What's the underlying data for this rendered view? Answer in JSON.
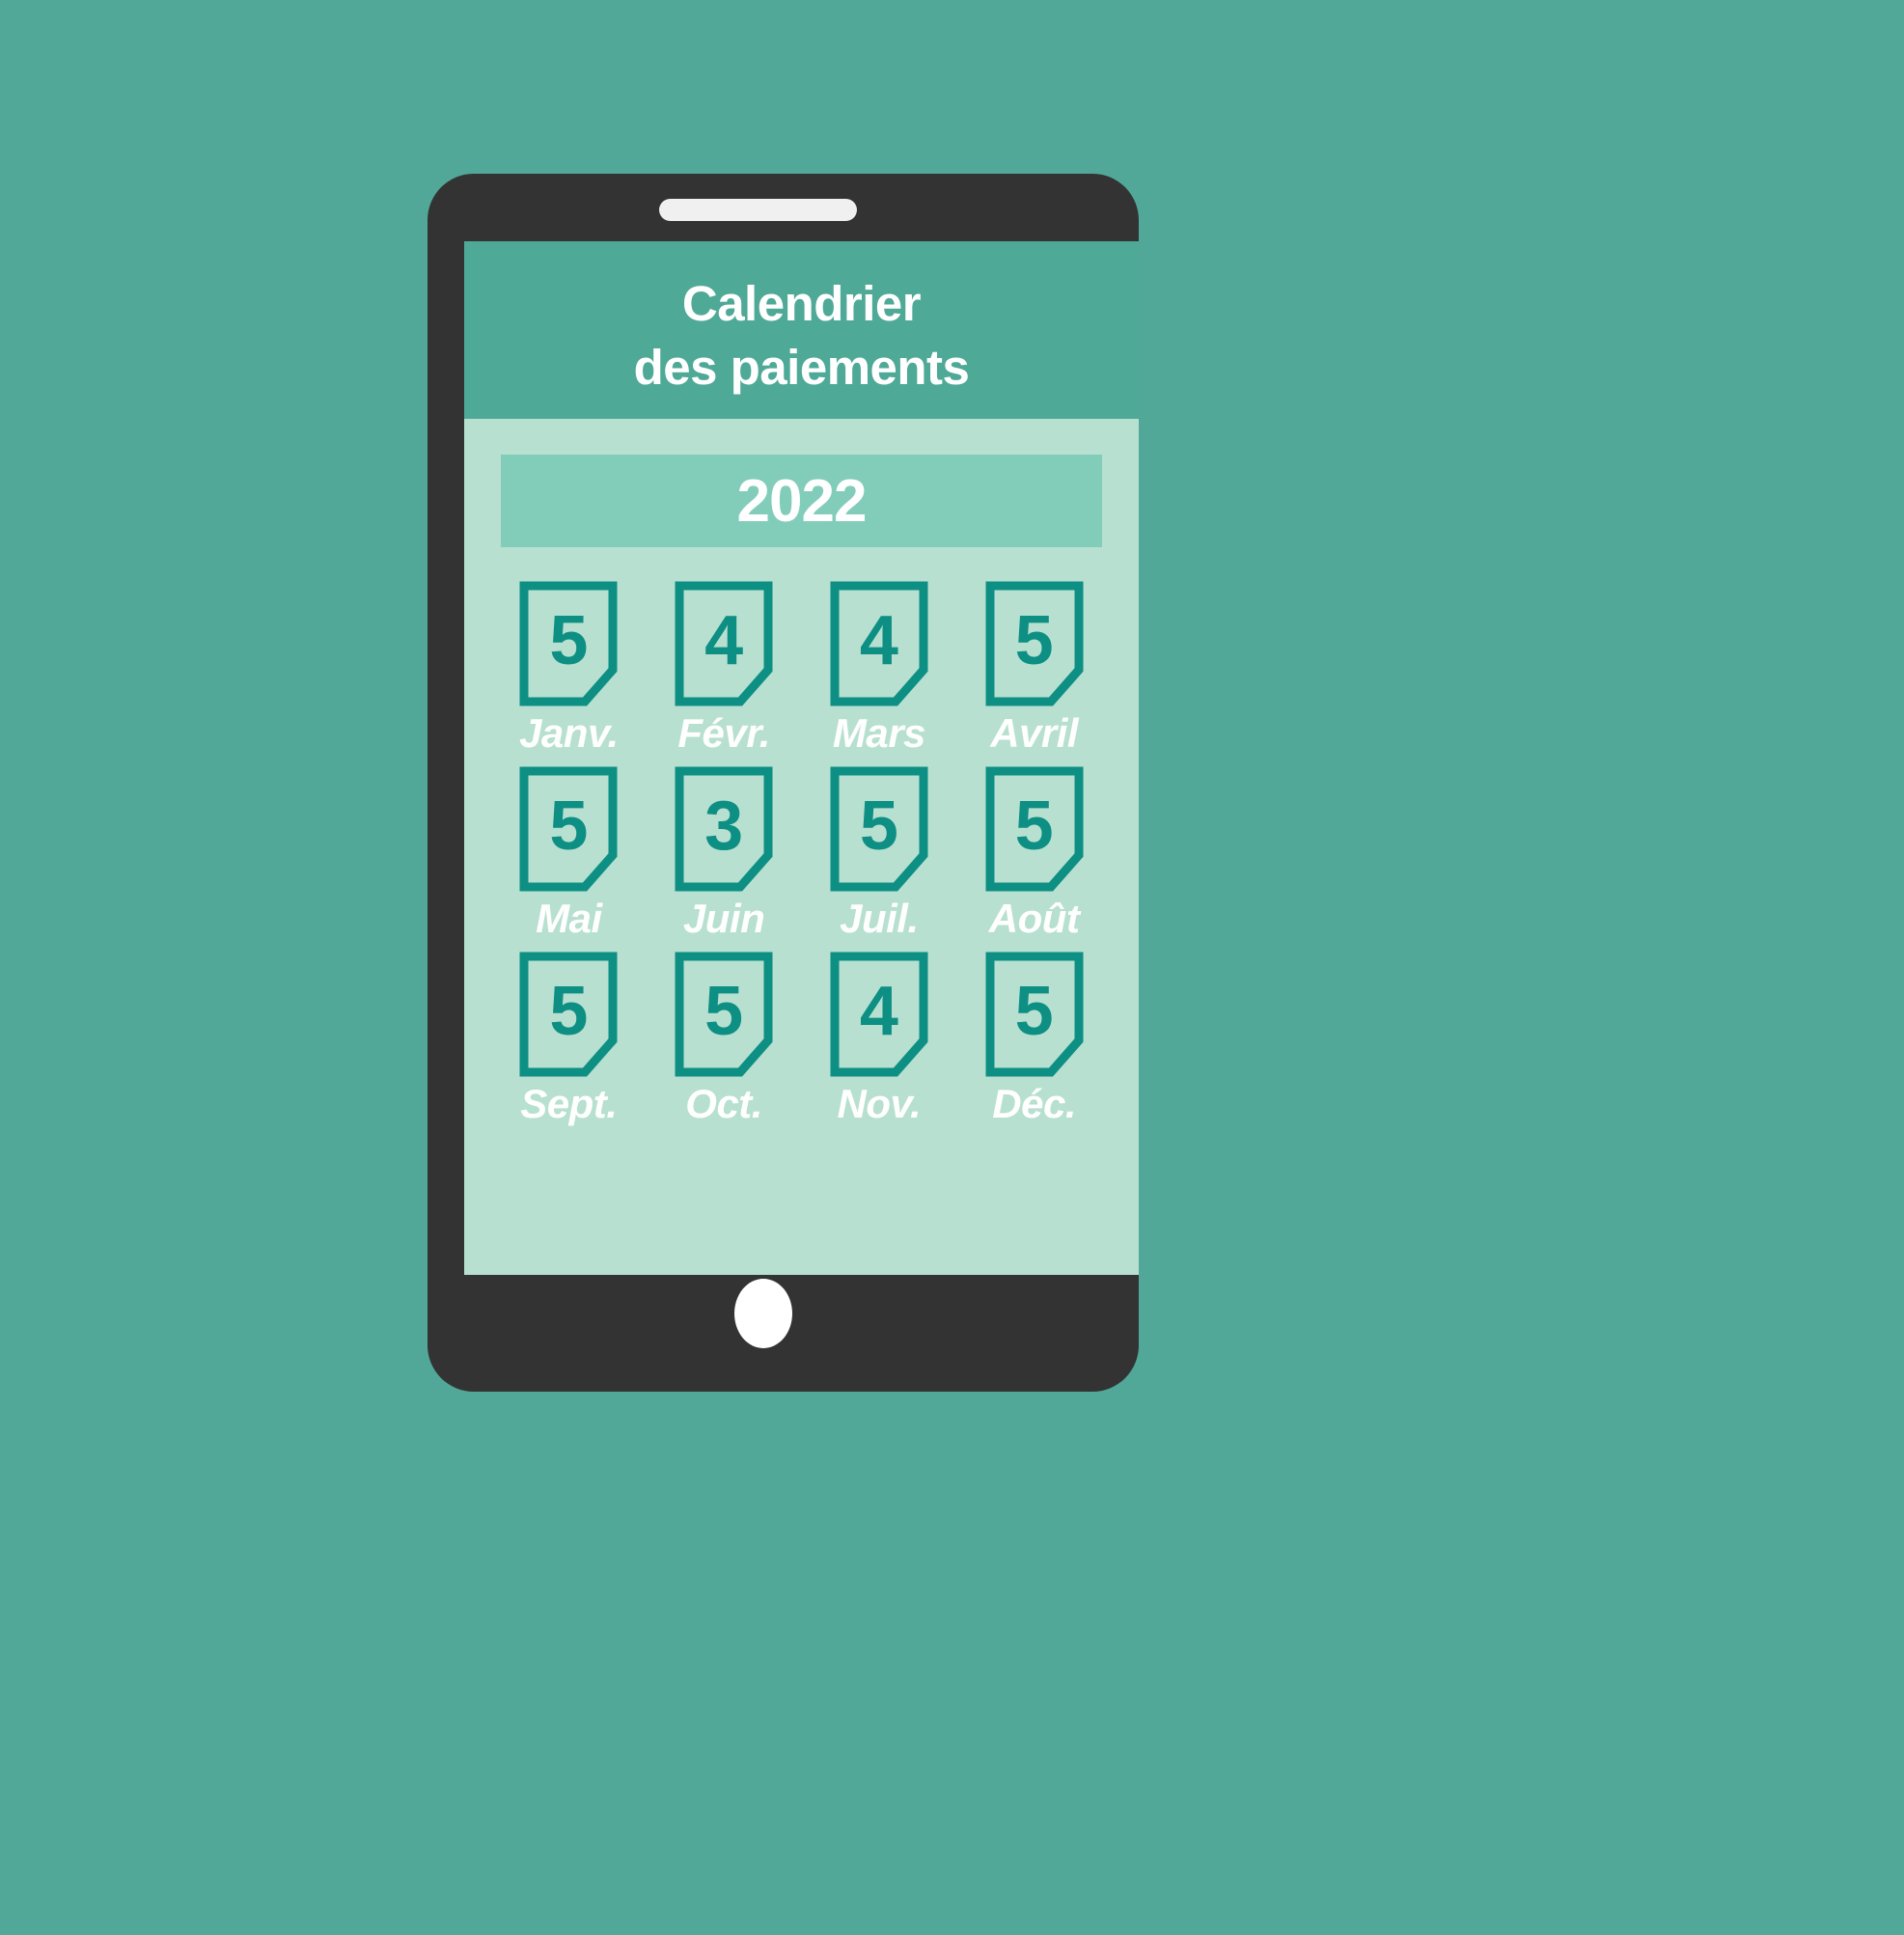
{
  "theme": {
    "page_background": "#52a898",
    "device_frame": "#333333",
    "screen_background": "#b7e0d1",
    "header_background": "#4fa997",
    "year_banner_background": "#82cdba",
    "accent": "#0d8f83",
    "text_on_dark": "#ffffff",
    "speaker_color": "#f0f0f0",
    "home_button_color": "#ffffff"
  },
  "device": {
    "speaker_name": "speaker-slot",
    "home_button_name": "home-button"
  },
  "header": {
    "title_line1": "Calendrier",
    "title_line2": "des paiements"
  },
  "year_selector": {
    "value": "2022"
  },
  "months": [
    {
      "label": "Janv.",
      "count": "5"
    },
    {
      "label": "Févr.",
      "count": "4"
    },
    {
      "label": "Mars",
      "count": "4"
    },
    {
      "label": "Avril",
      "count": "5"
    },
    {
      "label": "Mai",
      "count": "5"
    },
    {
      "label": "Juin",
      "count": "3"
    },
    {
      "label": "Juil.",
      "count": "5"
    },
    {
      "label": "Août",
      "count": "5"
    },
    {
      "label": "Sept.",
      "count": "5"
    },
    {
      "label": "Oct.",
      "count": "5"
    },
    {
      "label": "Nov.",
      "count": "4"
    },
    {
      "label": "Déc.",
      "count": "5"
    }
  ]
}
